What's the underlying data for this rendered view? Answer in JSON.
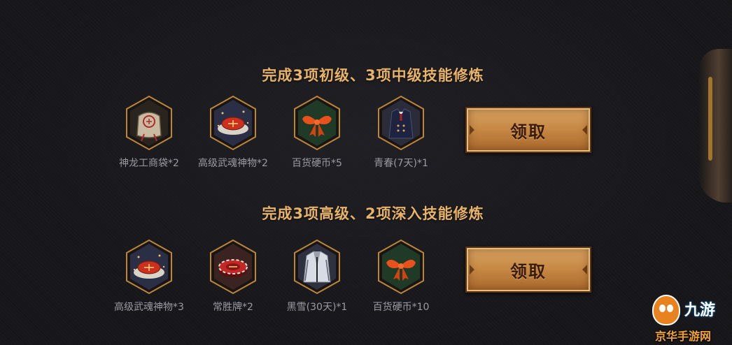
{
  "section1": {
    "title": "完成3项初级、3项中级技能修炼",
    "rewards": [
      {
        "label": "神龙工商袋*2",
        "icon": "pouch-icon"
      },
      {
        "label": "高级武魂神物*2",
        "icon": "soul-plate-icon"
      },
      {
        "label": "百货硬币*5",
        "icon": "gift-bow-icon"
      },
      {
        "label": "青春(7天)*1",
        "icon": "uniform-costume-icon"
      }
    ],
    "claim_label": "领取"
  },
  "section2": {
    "title": "完成3项高级、2项深入技能修炼",
    "rewards": [
      {
        "label": "高级武魂神物*3",
        "icon": "soul-plate-icon"
      },
      {
        "label": "常胜牌*2",
        "icon": "chip-icon"
      },
      {
        "label": "黑雪(30天)*1",
        "icon": "coat-costume-icon"
      },
      {
        "label": "百货硬币*10",
        "icon": "gift-bow-icon"
      }
    ],
    "claim_label": "领取"
  },
  "watermark": {
    "brand": "九游",
    "site": "京华手游网"
  },
  "colors": {
    "title": "#e7b368",
    "label": "#9a9aa2",
    "hex_border": "#b8863c",
    "button": "#c88a46"
  }
}
